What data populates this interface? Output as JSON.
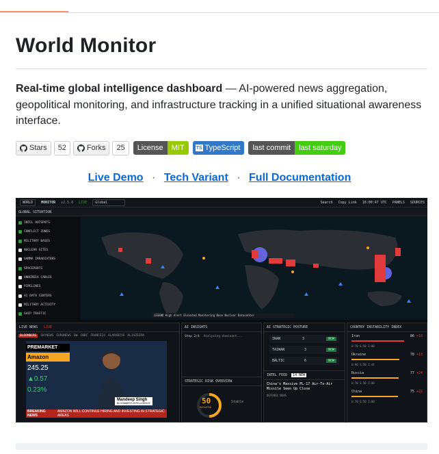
{
  "readme": {
    "title": "World Monitor",
    "description_bold": "Real-time global intelligence dashboard",
    "description_rest": " — AI-powered news aggregation, geopolitical monitoring, and infrastructure tracking in a unified situational awareness interface."
  },
  "badges": {
    "stars_label": "Stars",
    "stars_count": "52",
    "forks_label": "Forks",
    "forks_count": "25",
    "license_label": "License",
    "license_value": "MIT",
    "ts_label": "TypeScript",
    "commit_label": "last commit",
    "commit_value": "last saturday"
  },
  "links": {
    "live_demo": "Live Demo",
    "tech_variant": "Tech Variant",
    "full_docs": "Full Documentation",
    "separator": "·"
  },
  "screenshot": {
    "topbar": {
      "world": "WORLD",
      "monitor": "MONITOR",
      "version": "v2.5.0",
      "live": "LIVE",
      "region": "Global",
      "search": "Search",
      "copy_link": "Copy Link",
      "time": "18:00:47 UTC",
      "panels": "PANELS",
      "sources": "SOURCES"
    },
    "global_situation": "GLOBAL SITUATION",
    "layers": [
      {
        "label": "INTEL HOTSPOTS",
        "on": true
      },
      {
        "label": "CONFLICT ZONES",
        "on": true
      },
      {
        "label": "MILITARY BASES",
        "on": true
      },
      {
        "label": "NUCLEAR SITES",
        "on": false
      },
      {
        "label": "GAMMA IRRADIATORS",
        "on": false
      },
      {
        "label": "SPACEPORTS",
        "on": true
      },
      {
        "label": "UNDERSEA CABLES",
        "on": false
      },
      {
        "label": "PIPELINES",
        "on": false
      },
      {
        "label": "AI DATA CENTERS",
        "on": false
      },
      {
        "label": "MILITARY ACTIVITY",
        "on": false
      },
      {
        "label": "SHIP TRAFFIC",
        "on": true
      }
    ],
    "legend": "LEGEND  High Alert  Elevated  Monitoring  Base  Nuclear  Datacenter",
    "live_news": {
      "title": "LIVE NEWS",
      "live": "LIVE",
      "tabs": [
        "BLOOMBERG",
        "SKYNEWS",
        "EURONEWS",
        "DW",
        "CNBC",
        "FRANCE24",
        "ALARABIYA",
        "ALJAZEERA"
      ],
      "premarket": "PREMARKET",
      "ticker": "Amazon",
      "price": "245.25",
      "change": "▲0.57",
      "pct": "0.23%",
      "name": "Mandeep Singh",
      "org": "BLOOMBERG INTELLIGENCE",
      "breaking": "BREAKING NEWS",
      "headline": "AMAZON WILL CONTINUE HIRING AND INVESTING IN STRATEGIC AREAS"
    },
    "ai_insights": {
      "title": "AI INSIGHTS",
      "step": "Step 2/4",
      "status": "Analyzing dominant..."
    },
    "risk": {
      "title": "STRATEGIC RISK OVERVIEW",
      "score": "50",
      "level": "ELEVATED",
      "trend_label": "TREND",
      "trend": "Stable"
    },
    "posture": {
      "title": "AI STRATEGIC POSTURE",
      "rows": [
        {
          "name": "IRAN",
          "count": "3",
          "status": "NOW"
        },
        {
          "name": "TAIWAN",
          "count": "3",
          "status": "NOW"
        },
        {
          "name": "BALTIC",
          "count": "6",
          "status": "NOW"
        }
      ]
    },
    "intel_feed": {
      "title": "INTEL FEED",
      "count": "14 NEW",
      "headline": "China's Massive PL-17 Air-To-Air Missile Seen Up Close",
      "meta": "DEFENSE NEWS"
    },
    "cii": {
      "title": "COUNTRY INSTABILITY INDEX",
      "rows": [
        {
          "country": "Iran",
          "score": "86",
          "delta": "+10",
          "sub": "U:70  S:50  I:80",
          "fill": 0.86
        },
        {
          "country": "Ukraine",
          "score": "78",
          "delta": "+13",
          "sub": "U:96  S:50  I:44",
          "fill": 0.78
        },
        {
          "country": "Russia",
          "score": "77",
          "delta": "+24",
          "sub": "U:70  S:50  I:80",
          "fill": 0.77
        },
        {
          "country": "China",
          "score": "75",
          "delta": "+22",
          "sub": "U:70  S:50  I:80",
          "fill": 0.75
        }
      ]
    }
  }
}
